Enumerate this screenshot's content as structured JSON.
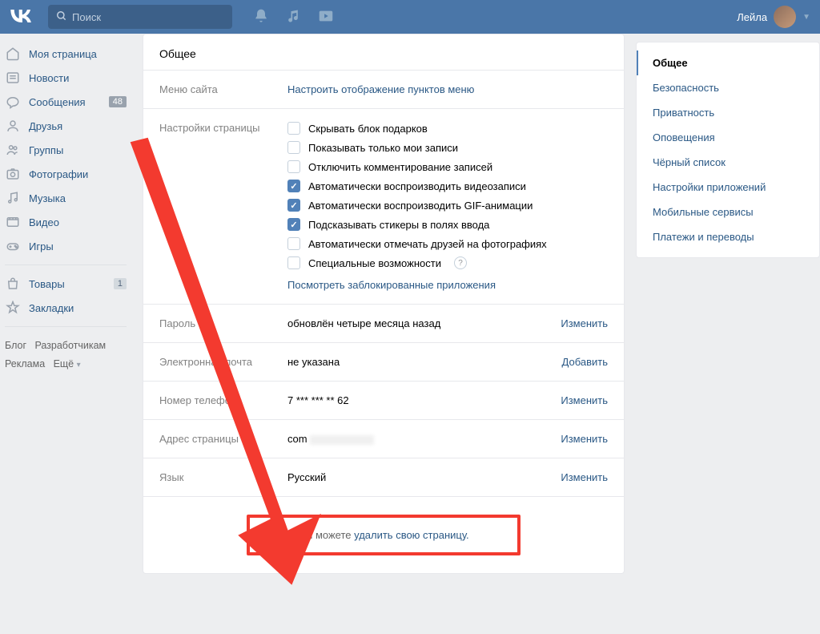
{
  "header": {
    "search_placeholder": "Поиск",
    "user_name": "Лейла"
  },
  "left_nav": {
    "items": [
      {
        "icon": "home",
        "label": "Моя страница",
        "truncated": true
      },
      {
        "icon": "news",
        "label": "Новости"
      },
      {
        "icon": "messages",
        "label": "Сообщения",
        "badge": "48"
      },
      {
        "icon": "friends",
        "label": "Друзья"
      },
      {
        "icon": "groups",
        "label": "Группы"
      },
      {
        "icon": "photos",
        "label": "Фотографии"
      },
      {
        "icon": "music",
        "label": "Музыка"
      },
      {
        "icon": "video",
        "label": "Видео"
      },
      {
        "icon": "games",
        "label": "Игры"
      }
    ],
    "secondary": [
      {
        "icon": "market",
        "label": "Товары",
        "badge": "1"
      },
      {
        "icon": "bookmarks",
        "label": "Закладки"
      }
    ],
    "footer": {
      "blog": "Блог",
      "devs": "Разработчикам",
      "ads": "Реклама",
      "more": "Ещё"
    }
  },
  "content": {
    "title": "Общее",
    "menu": {
      "label": "Меню сайта",
      "action": "Настроить отображение пунктов меню"
    },
    "page_settings": {
      "label": "Настройки страницы",
      "checks": [
        {
          "checked": false,
          "label": "Скрывать блок подарков"
        },
        {
          "checked": false,
          "label": "Показывать только мои записи"
        },
        {
          "checked": false,
          "label": "Отключить комментирование записей"
        },
        {
          "checked": true,
          "label": "Автоматически воспроизводить видеозаписи"
        },
        {
          "checked": true,
          "label": "Автоматически воспроизводить GIF-анимации"
        },
        {
          "checked": true,
          "label": "Подсказывать стикеры в полях ввода"
        },
        {
          "checked": false,
          "label": "Автоматически отмечать друзей на фотографиях"
        },
        {
          "checked": false,
          "label": "Специальные возможности",
          "help": true
        }
      ],
      "blocked_apps": "Посмотреть заблокированные приложения"
    },
    "password": {
      "label": "Пароль",
      "value": "обновлён четыре месяца назад",
      "action": "Изменить"
    },
    "email": {
      "label": "Электронная почта",
      "value": "не указана",
      "action": "Добавить"
    },
    "phone": {
      "label": "Номер телефона",
      "value": "7 *** *** ** 62",
      "action": "Изменить"
    },
    "address": {
      "label": "Адрес страницы",
      "value_prefix": "",
      "value_domain": "com",
      "action": "Изменить"
    },
    "lang": {
      "label": "Язык",
      "value": "Русский",
      "action": "Изменить"
    },
    "delete": {
      "prefix": "Вы можете ",
      "link": "удалить свою страницу."
    }
  },
  "right_nav": {
    "items": [
      {
        "label": "Общее",
        "active": true
      },
      {
        "label": "Безопасность"
      },
      {
        "label": "Приватность"
      },
      {
        "label": "Оповещения"
      },
      {
        "label": "Чёрный список"
      },
      {
        "label": "Настройки приложений"
      },
      {
        "label": "Мобильные сервисы"
      },
      {
        "label": "Платежи и переводы"
      }
    ]
  }
}
